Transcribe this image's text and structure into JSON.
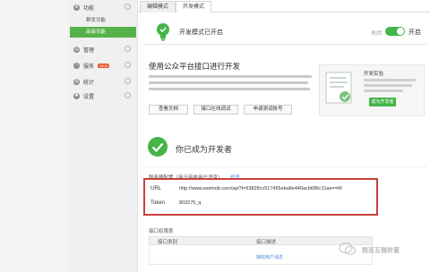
{
  "sidebar": {
    "groups": [
      {
        "label": "功能",
        "icon": "function-icon",
        "badge": ""
      },
      {
        "label": "管理",
        "icon": "folder-icon",
        "badge": ""
      },
      {
        "label": "服务",
        "icon": "service-icon",
        "badge": "NEW"
      },
      {
        "label": "统计",
        "icon": "chart-icon",
        "badge": ""
      },
      {
        "label": "设置",
        "icon": "settings-icon",
        "badge": ""
      }
    ],
    "sub_items": [
      "群发功能",
      "高级功能"
    ]
  },
  "tabs": [
    "编辑模式",
    "开发模式"
  ],
  "dev_mode": {
    "status_text": "开发模式已开启",
    "toggle_off_label": "关闭",
    "toggle_on_label": "开启",
    "enabled": true
  },
  "coop": {
    "title": "使用公众平台接口进行开发",
    "buttons": [
      "查看文档",
      "接口在线调试",
      "申请测试帐号"
    ]
  },
  "card": {
    "title": "开发实验",
    "button": "成为开发者"
  },
  "developer": {
    "title": "你已成为开发者",
    "config_label": "服务器配置（用于接收用户消息）",
    "edit_link": "修改",
    "url_label": "URL",
    "url_value": "http://www.weimob.com/api?t=93828cc517455eba8e440acb686c11ae==M",
    "token_label": "Token",
    "token_value": "803275_q"
  },
  "api": {
    "section_title": "接口权限表",
    "columns": [
      "接口类别",
      "接口描述"
    ],
    "row_link": "接收用户消息"
  },
  "watermark": {
    "text": "精英互微聆置"
  },
  "colors": {
    "accent_green": "#44b549",
    "highlight_red": "#c9403a",
    "link_blue": "#4a8ad6"
  }
}
